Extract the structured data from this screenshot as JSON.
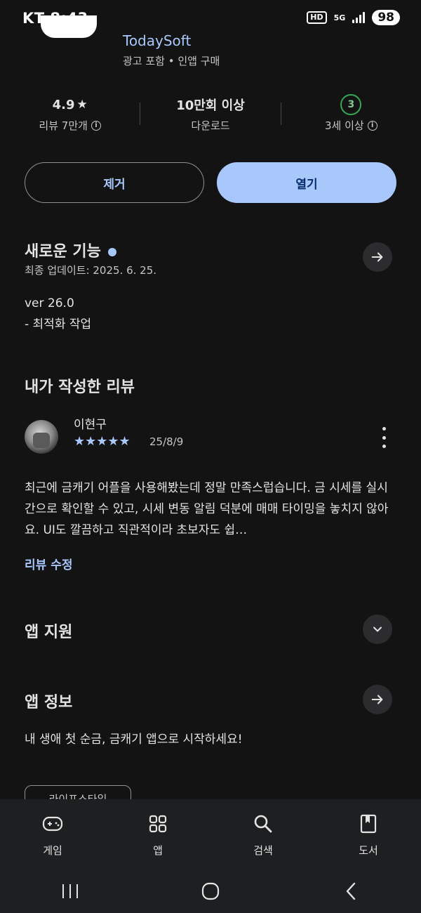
{
  "status_bar": {
    "carrier_time": "KT 8:43",
    "hd": "HD",
    "network": "5G",
    "battery": "98"
  },
  "app": {
    "developer": "TodaySoft",
    "meta": "광고 포함  •  인앱 구매"
  },
  "stats": {
    "rating": "4.9",
    "reviews": "리뷰 7만개",
    "downloads": "10만회 이상",
    "downloads_label": "다운로드",
    "age_badge": "3",
    "age_label": "3세 이상"
  },
  "buttons": {
    "uninstall": "제거",
    "open": "열기"
  },
  "whats_new": {
    "title": "새로운 기능",
    "updated": "최종 업데이트: 2025. 6. 25.",
    "version": "ver 26.0",
    "notes": "- 최적화 작업"
  },
  "my_review": {
    "title": "내가 작성한 리뷰",
    "reviewer": "이현구",
    "rating": 5,
    "stars": "★★★★★",
    "date": "25/8/9",
    "text": "최근에 금캐기 어플을 사용해봤는데 정말 만족스럽습니다. 금 시세를 실시간으로 확인할 수 있고, 시세 변동 알림 덕분에 매매 타이밍을 놓치지 않아요. UI도 깔끔하고 직관적이라 초보자도 쉽…",
    "edit_link": "리뷰 수정"
  },
  "app_support": {
    "title": "앱 지원"
  },
  "app_info": {
    "title": "앱 정보",
    "description": "내 생애 첫 순금, 금캐기 앱으로 시작하세요!",
    "chip": "라이프스타일"
  },
  "bottom_nav": [
    {
      "label": "게임",
      "icon": "gamepad-icon"
    },
    {
      "label": "앱",
      "icon": "apps-grid-icon"
    },
    {
      "label": "검색",
      "icon": "search-icon"
    },
    {
      "label": "도서",
      "icon": "book-icon"
    }
  ]
}
